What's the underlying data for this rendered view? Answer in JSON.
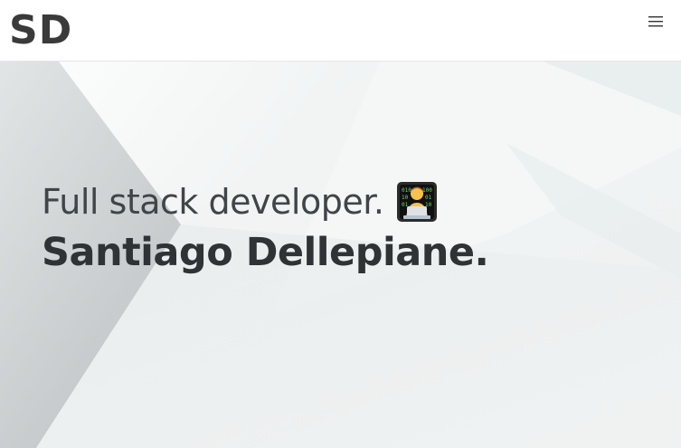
{
  "navbar": {
    "logo": "SD",
    "menu_icon": "hamburger-menu-icon"
  },
  "hero": {
    "subtitle": "Full stack developer.",
    "subtitle_icon": "technologist-emoji-icon",
    "name": "Santiago Dellepiane."
  },
  "colors": {
    "text": "#3a3a3a",
    "background": "#eef2f2",
    "navbar": "#ffffff"
  }
}
